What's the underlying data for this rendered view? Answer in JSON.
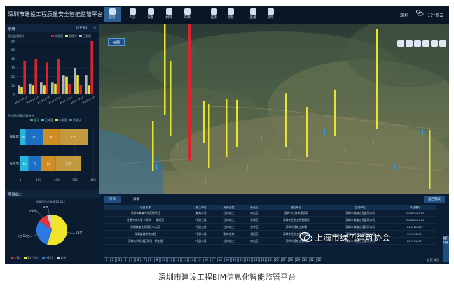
{
  "app": {
    "title": "深圳市建设工程质量安全智能监管平台"
  },
  "nav": [
    {
      "label": "首页",
      "icon": "home-icon"
    },
    {
      "label": "人员",
      "icon": "person-icon"
    },
    {
      "label": "设备",
      "icon": "device-icon"
    },
    {
      "label": "材料",
      "icon": "material-icon"
    },
    {
      "label": "车辆",
      "icon": "vehicle-icon"
    },
    {
      "label": "监测",
      "icon": "monitor-icon"
    },
    {
      "label": "视频",
      "icon": "video-icon"
    },
    {
      "label": "监督",
      "icon": "supervise-icon"
    },
    {
      "label": "质检",
      "icon": "inspection-icon"
    }
  ],
  "topbar": {
    "city": "深圳",
    "temp": "17°多云",
    "weather_icon": "weather-cloud-icon"
  },
  "left_panel": {
    "header": {
      "title": "航线",
      "right": "历史统计",
      "close": "«"
    },
    "chart1": {
      "title": "巡检监测统计",
      "legend": [
        "未处理",
        "处理中",
        "已处理"
      ]
    },
    "chart2": {
      "title": "危险源/质量问题统计",
      "legend": [
        "总计",
        "已处理",
        "未处理",
        "待确认"
      ]
    },
    "section2": {
      "title": "项目统计",
      "note": "质量项目总数量15,312"
    },
    "pie_legend": [
      "<1亿",
      "1亿-10亿",
      ">10亿",
      "其他"
    ]
  },
  "map": {
    "back_button": "返回"
  },
  "bottom": {
    "tabs": [
      "项目",
      "详情"
    ],
    "back_list": "返回列表",
    "side_button": "展开列表",
    "columns": [
      "项目名称",
      "施工单位",
      "形象进度",
      "所在区",
      "建设单位",
      "监理单位",
      "项目编号"
    ],
    "rows": [
      [
        "深圳市某某大学医院项目",
        "某某公司",
        "主体施工",
        "南山区",
        "深圳市住房和建设局",
        "深圳市某某工程监理公司",
        "1562916.573"
      ],
      [
        "香港中文大学（深圳）一期项目",
        "中建三局",
        "主体施工",
        "龙岗区",
        "深圳市住宅工程管理站",
        "深圳市某某工程监理公司",
        "1562811.944"
      ],
      [
        "深圳某某住宅项目A1标段",
        "中建五局",
        "主体施工",
        "龙华区",
        "深圳市建筑工务署",
        "深圳市某某工程顾问公司",
        "214122.867"
      ],
      [
        "深圳某某学校工程",
        "中建二局",
        "装饰装修",
        "福田区",
        "深圳市住宅工程管理站",
        "深圳市某某工程监理公司",
        "192354.921"
      ],
      [
        "深圳大学新校区项目一期工程",
        "中建八局",
        "主体施工",
        "南山区",
        "深圳市建筑工务署",
        "深圳市某某工程监理公司",
        "202791.471"
      ]
    ],
    "pager_pages": [
      "1",
      "2",
      "3",
      "4",
      "5",
      "6",
      "7",
      "8",
      "9",
      "10",
      "11",
      "12",
      "13",
      "14",
      "15",
      "16",
      "17",
      "18",
      "19",
      "20",
      "21",
      "22",
      "23",
      "24",
      "25",
      "26",
      "27",
      "28",
      "29",
      "30",
      "31",
      "32"
    ],
    "pager_right": "首页 末页"
  },
  "watermark": {
    "text": "上海市绿色建筑协会",
    "logo": "wechat-logo"
  },
  "caption": "深圳市建设工程BIM信息化智能监管平台",
  "colors": {
    "red": "#d9232d",
    "yellow": "#e8e230",
    "gray": "#b5b5b5",
    "blue": "#1e90d8",
    "cyan": "#22c4e0",
    "orange": "#e89a28",
    "green": "#2fb05a",
    "pie_yellow": "#f0e52a",
    "pie_blue": "#2c7be5",
    "pie_red": "#e8333a",
    "pie_gray": "#cfcfcf"
  },
  "chart_data": [
    {
      "type": "bar",
      "title": "巡检监测统计",
      "categories": [
        "2019-07-01",
        "2019-08-01",
        "2019-09-01",
        "2019-10-01",
        "2019-11-01",
        "2019-12-01",
        "2020-01-01"
      ],
      "series": [
        {
          "name": "未处理",
          "values": [
            38,
            40,
            36,
            40,
            12,
            10,
            60
          ]
        },
        {
          "name": "处理中",
          "values": [
            8,
            10,
            10,
            12,
            20,
            22,
            10
          ]
        },
        {
          "name": "已处理",
          "values": [
            10,
            12,
            14,
            14,
            22,
            30,
            22
          ]
        }
      ],
      "ylim": [
        0,
        60
      ],
      "yticks": [
        0,
        10,
        20,
        30,
        40,
        50,
        60
      ]
    },
    {
      "type": "bar",
      "orientation": "horizontal",
      "title": "危险源/质量问题统计",
      "categories": [
        "未处理",
        "已处理"
      ],
      "series": [
        {
          "name": "A",
          "values": [
            30,
            45
          ]
        },
        {
          "name": "B",
          "values": [
            95,
            70
          ]
        },
        {
          "name": "C",
          "values": [
            90,
            80
          ]
        },
        {
          "name": "D",
          "values": [
            155,
            137
          ]
        }
      ],
      "xticks": [
        0,
        100,
        200,
        300,
        400
      ],
      "xlim": [
        0,
        400
      ]
    },
    {
      "type": "pie",
      "labels": [
        "<1亿",
        "1亿-10亿",
        ">10亿",
        "其他"
      ],
      "values": [
        55,
        30,
        10,
        5
      ]
    }
  ],
  "map_bars": [
    {
      "color": "red",
      "height": 0.95
    },
    {
      "color": "yellow",
      "height": 0.45
    },
    {
      "color": "yellow",
      "height": 0.55
    },
    {
      "color": "yellow",
      "height": 0.3
    },
    {
      "color": "yellow",
      "height": 0.38
    },
    {
      "color": "yellow",
      "height": 0.35
    },
    {
      "color": "yellow",
      "height": 0.28
    },
    {
      "color": "yellow",
      "height": 0.25
    },
    {
      "color": "yellow",
      "height": 0.32
    },
    {
      "color": "yellow",
      "height": 0.3
    },
    {
      "color": "yellow",
      "height": 0.28
    },
    {
      "color": "yellow",
      "height": 0.6
    },
    {
      "color": "yellow",
      "height": 0.35
    }
  ]
}
